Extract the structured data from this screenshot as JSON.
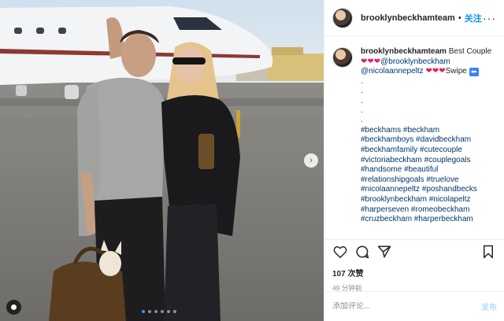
{
  "post": {
    "username": "brooklynbeckhamteam",
    "separator": "•",
    "follow_label": "关注",
    "more_label": "···",
    "caption": {
      "username": "brooklynbeckhamteam",
      "line1_text": "Best Couple",
      "hearts": "❤❤❤",
      "mention1": "@brooklynbeckham",
      "mention2": "@nicolaannepeltz",
      "swipe_text": "Swipe",
      "swipe_icon": "⬅",
      "dots": [
        ".",
        ".",
        ".",
        ".",
        "."
      ],
      "hashtag_lines": [
        "#beckhams #beckham",
        "#beckhamboys #davidbeckham",
        "#beckhamfamily #cutecouple",
        "#victoriabeckham #couplegoals",
        "#handsome #beautiful",
        "#relationshipgoals #truelove",
        "#nicolaannepeltz #poshandbecks",
        "#brooklynbeckham #nicolapeltz",
        "#harperseven #romeobeckham",
        "#cruzbeckham #harperbeckham"
      ]
    },
    "likes": "107 次赞",
    "time": "49 分钟前",
    "comment_placeholder": "添加评论...",
    "post_label": "发布"
  },
  "carousel": {
    "next_icon": "›",
    "slide_count": 6,
    "active_index": 0
  },
  "colors": {
    "link": "#0095f6",
    "hashtag": "#00376b",
    "heart": "#e0245e",
    "post_disabled": "#b2dffc"
  }
}
